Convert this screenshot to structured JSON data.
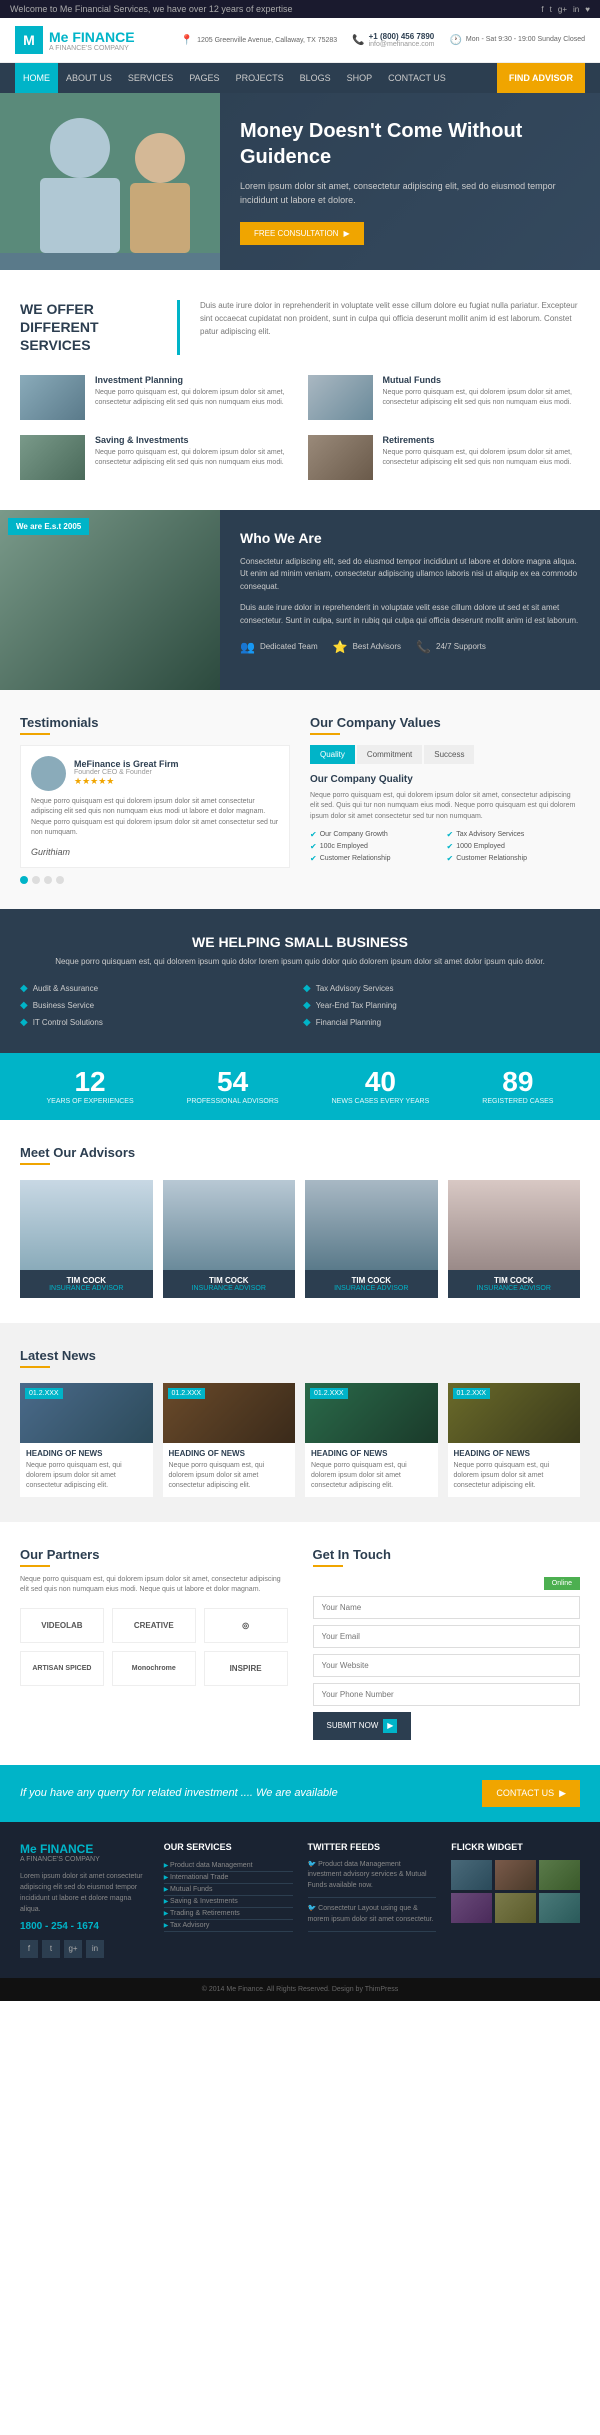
{
  "topbar": {
    "welcome": "Welcome to Me Financial Services, we have over 12 years of expertise",
    "address": "1205 Greenville Avenue, Callaway, TX 75283",
    "phone": "+1 (800) 456 7890",
    "email": "info@mefinance.com",
    "hours": "Mon - Sat 9:30 - 19:00 Sunday Closed",
    "social": [
      "f",
      "t",
      "g+",
      "in",
      "♥"
    ]
  },
  "header": {
    "logo_letter": "M",
    "logo_title": "Me FINANCE",
    "logo_subtitle": "A FINANCE'S COMPANY",
    "phone_icon": "📞",
    "address_icon": "📍",
    "hours_icon": "🕐"
  },
  "nav": {
    "items": [
      "HOME",
      "ABOUT US",
      "SERVICES",
      "PAGES",
      "PROJECTS",
      "BLOGS",
      "SHOP",
      "CONTACT US"
    ],
    "cta": "FIND ADVISOR"
  },
  "hero": {
    "title": "Money Doesn't Come Without Guidence",
    "description": "Lorem ipsum dolor sit amet, consectetur adipiscing elit, sed do eiusmod tempor incididunt ut labore et dolore.",
    "button": "FREE CONSULTATION"
  },
  "services_section": {
    "heading": "WE OFFER DIFFERENT SERVICES",
    "description": "Duis aute irure dolor in reprehenderit in voluptate velit esse cillum dolore eu fugiat nulla pariatur. Excepteur sint occaecat cupidatat non proident, sunt in culpa qui officia deserunt mollit anim id est laborum. Constet patur adipiscing elit.",
    "items": [
      {
        "title": "Investment Planning",
        "text": "Neque porro quisquam est, qui dolorem ipsum dolor sit amet, consectetur adipiscing elit sed quis non numquam eius modi."
      },
      {
        "title": "Mutual Funds",
        "text": "Neque porro quisquam est, qui dolorem ipsum dolor sit amet, consectetur adipiscing elit sed quis non numquam eius modi."
      },
      {
        "title": "Saving & Investments",
        "text": "Neque porro quisquam est, qui dolorem ipsum dolor sit amet, consectetur adipiscing elit sed quis non numquam eius modi."
      },
      {
        "title": "Retirements",
        "text": "Neque porro quisquam est, qui dolorem ipsum dolor sit amet, consectetur adipiscing elit sed quis non numquam eius modi."
      }
    ]
  },
  "who_section": {
    "badge": "We are E.s.t 2005",
    "heading": "Who We Are",
    "para1": "Consectetur adipiscing elit, sed do eiusmod tempor incididunt ut labore et dolore magna aliqua. Ut enim ad minim veniam, consectetur adipiscing ullamco laboris nisi ut aliquip ex ea commodo consequat.",
    "para2": "Duis aute irure dolor in reprehenderit in voluptate velit esse cillum dolore ut sed et sit amet consectetur. Sunt in culpa, sunt in rubiq qui culpa qui officia deserunt mollit anim id est laborum.",
    "stats": [
      {
        "icon": "👥",
        "label": "Dedicated Team"
      },
      {
        "icon": "⭐",
        "label": "Best Advisors"
      },
      {
        "icon": "📞",
        "label": "24/7 Supports"
      }
    ]
  },
  "testimonials": {
    "heading": "Testimonials",
    "card": {
      "name": "MeFinance is Great Firm",
      "role": "Founder CEO & Founder",
      "stars": "★★★★★",
      "text": "Neque porro quisquam est qui dolorem ipsum dolor sit amet consectetur adipiscing elit sed quis non numquam eius modi ut labore et dolor magnam. Neque porro quisquam est qui dolorem ipsum dolor sit amet consectetur sed tur non numquam.",
      "signature": "Gurithiam"
    },
    "dots": [
      true,
      false,
      false,
      false
    ]
  },
  "company_values": {
    "heading": "Our Company Values",
    "tabs": [
      "Quality",
      "Commitment",
      "Success"
    ],
    "active_tab": 0,
    "content_heading": "Our Company Quality",
    "content_text": "Neque porro quisquam est, qui dolorem ipsum dolor sit amet, consectetur adipiscing elit sed. Quis qui tur non numquam eius modi. Neque porro quisquam est qui dolorem ipsum dolor sit amet consectetur sed tur non numquam.",
    "list_items": [
      "Our Company Growth",
      "Tax Advisory Services",
      "100c Employed",
      "1000 Employed",
      "Customer Relationship",
      "Customer Relationship"
    ]
  },
  "helping": {
    "heading": "WE HELPING SMALL BUSINESS",
    "description": "Neque porro quisquam est, qui dolorem ipsum quio dolor lorem ipsum quio dolor quio dolorem ipsum dolor sit amet dolor ipsum quio dolor.",
    "items": [
      "Audit & Assurance",
      "Tax Advisory Services",
      "Business Service",
      "Year-End Tax Planning",
      "IT Control Solutions",
      "Financial Planning"
    ]
  },
  "stats": [
    {
      "number": "12",
      "label": "YEARS OF EXPERIENCES"
    },
    {
      "number": "54",
      "label": "PROFESSIONAL ADVISORS"
    },
    {
      "number": "40",
      "label": "NEWS CASES EVERY YEARS"
    },
    {
      "number": "89",
      "label": "REGISTERED CASES"
    }
  ],
  "advisors": {
    "heading": "Meet Our Advisors",
    "items": [
      {
        "name": "TIM COCK",
        "role": "INSURANCE ADVISOR"
      },
      {
        "name": "TIM COCK",
        "role": "INSURANCE ADVISOR"
      },
      {
        "name": "TIM COCK",
        "role": "INSURANCE ADVISOR"
      },
      {
        "name": "TIM COCK",
        "role": "INSURANCE ADVISOR"
      }
    ]
  },
  "news": {
    "heading": "Latest News",
    "items": [
      {
        "date": "01.2.XXX",
        "title": "HEADING OF NEWS",
        "text": "Neque porro quisquam est, qui dolorem ipsum dolor sit amet consectetur adipiscing elit."
      },
      {
        "date": "01.2.XXX",
        "title": "HEADING OF NEWS",
        "text": "Neque porro quisquam est, qui dolorem ipsum dolor sit amet consectetur adipiscing elit."
      },
      {
        "date": "01.2.XXX",
        "title": "HEADING OF NEWS",
        "text": "Neque porro quisquam est, qui dolorem ipsum dolor sit amet consectetur adipiscing elit."
      },
      {
        "date": "01.2.XXX",
        "title": "HEADING OF NEWS",
        "text": "Neque porro quisquam est, qui dolorem ipsum dolor sit amet consectetur adipiscing elit."
      }
    ]
  },
  "partners": {
    "heading": "Our Partners",
    "description": "Neque porro quisquam est, qui dolorem ipsum dolor sit amet, consectetur adipiscing elit sed quis non numquam eius modi. Neque quis ut labore et dolor magnam.",
    "logos": [
      "VIDEOLAB",
      "CREATIVE",
      "◎",
      "ARTISAN SPICED",
      "Monochrome",
      "INSPIRE"
    ]
  },
  "contact_form": {
    "heading": "Get In Touch",
    "online_label": "Online",
    "fields": [
      {
        "placeholder": "Your Name"
      },
      {
        "placeholder": "Your Email"
      },
      {
        "placeholder": "Your Website"
      },
      {
        "placeholder": "Your Phone Number"
      }
    ],
    "submit": "SUBMIT NOW"
  },
  "cta_banner": {
    "text": "If you have any querry for related investment .... We are available",
    "button": "CONTACT US"
  },
  "footer": {
    "logo_title": "Me FINANCE",
    "logo_sub": "A FINANCE'S COMPANY",
    "about_text": "Lorem ipsum dolor sit amet consectetur adipiscing elit sed do eiusmod tempor incididunt ut labore et dolore magna aliqua.",
    "phone": "1800 - 254 - 1674",
    "services_heading": "Our Services",
    "services_items": [
      "Product data Management",
      "International Trade",
      "Mutual Funds",
      "Saving & Investments",
      "Trading & Retirements",
      "Tax Advisory"
    ],
    "twitter_heading": "Twitter Feeds",
    "tweets": [
      "Product data Management investment advisory services & Mutual Funds available now.",
      "Consectetur Layout using que & morem ipsum dolor sit amet consectetur."
    ],
    "flickr_heading": "Flickr Widget",
    "bottom_text": "© 2014 Me Finance. All Rights Reserved. Design by ThimPress"
  }
}
